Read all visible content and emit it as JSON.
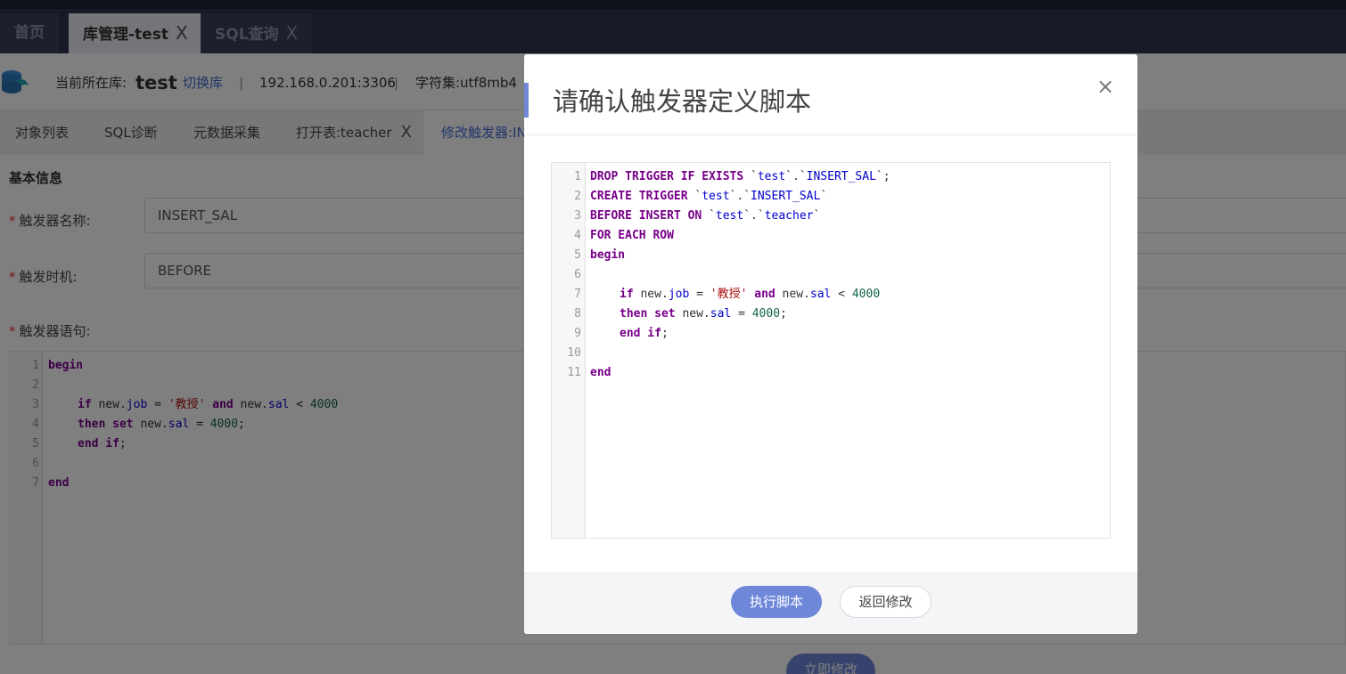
{
  "tabs": [
    {
      "label": "首页"
    },
    {
      "label": "库管理-test",
      "close": "X"
    },
    {
      "label": "SQL查询",
      "close": "X"
    }
  ],
  "db_bar": {
    "current_db_label": "当前所在库:",
    "db_name": "test",
    "switch_link": "切换库",
    "separator": "|",
    "host": "192.168.0.201:3306",
    "charset": "字符集:utf8mb4"
  },
  "subtabs": [
    {
      "label": "对象列表"
    },
    {
      "label": "SQL诊断"
    },
    {
      "label": "元数据采集"
    },
    {
      "label": "打开表:teacher",
      "close": "X"
    },
    {
      "label": "修改触发器:IN"
    }
  ],
  "form": {
    "section_title": "基本信息",
    "required_mark": "*",
    "trigger_name_label": "触发器名称:",
    "trigger_name_value": "INSERT_SAL",
    "trigger_time_label": "触发时机:",
    "trigger_time_value": "BEFORE",
    "trigger_stmt_label": "触发器语句:",
    "submit_label": "立即修改"
  },
  "bg_code": {
    "line_numbers": [
      "1",
      "2",
      "3",
      "4",
      "5",
      "6",
      "7"
    ],
    "l1": "begin",
    "l3_if": "if",
    "l3_new1": " new.",
    "l3_job": "job",
    "l3_eq": " = ",
    "l3_str": "'教授'",
    "l3_and": " and",
    "l3_new2": " new.",
    "l3_sal": "sal",
    "l3_lt": " < ",
    "l3_num": "4000",
    "l4_then": "then set",
    "l4_new": " new.",
    "l4_sal": "sal",
    "l4_eq": " = ",
    "l4_num": "4000",
    "l4_semi": ";",
    "l5_endif": "end if",
    "l5_semi": ";",
    "l7": "end"
  },
  "modal": {
    "title": "请确认触发器定义脚本",
    "close_icon": "×",
    "execute_button": "执行脚本",
    "back_button": "返回修改",
    "line_numbers": [
      "1",
      "2",
      "3",
      "4",
      "5",
      "6",
      "7",
      "8",
      "9",
      "10",
      "11"
    ],
    "code": {
      "l1_kw": "DROP TRIGGER IF EXISTS",
      "l1_q1": " `",
      "l1_db": "test",
      "l1_q2": "`.`",
      "l1_name": "INSERT_SAL",
      "l1_q3": "`;",
      "l2_kw": "CREATE TRIGGER",
      "l2_q1": " `",
      "l2_db": "test",
      "l2_q2": "`.`",
      "l2_name": "INSERT_SAL",
      "l2_q3": "`",
      "l3_kw": "BEFORE INSERT ON",
      "l3_q1": " `",
      "l3_db": "test",
      "l3_q2": "`.`",
      "l3_tbl": "teacher",
      "l3_q3": "`",
      "l4": "FOR EACH ROW",
      "l5": "begin",
      "l7_if": "if",
      "l7_new1": " new.",
      "l7_job": "job",
      "l7_eq": " = ",
      "l7_str": "'教授'",
      "l7_and": " and",
      "l7_new2": " new.",
      "l7_sal": "sal",
      "l7_lt": " < ",
      "l7_num": "4000",
      "l8_then": "then set",
      "l8_new": " new.",
      "l8_sal": "sal",
      "l8_eq": " = ",
      "l8_num": "4000",
      "l8_semi": ";",
      "l9_endif": "end if",
      "l9_semi": ";",
      "l11": "end"
    }
  },
  "colors": {
    "primary": "#6f87d9",
    "header_dark": "#2e3250",
    "keyword": "#770088",
    "string": "#aa1111",
    "number": "#116644",
    "variable": "#0000cc"
  },
  "icons": {
    "db_logo": "database-dolphin-icon",
    "close": "close-icon"
  }
}
